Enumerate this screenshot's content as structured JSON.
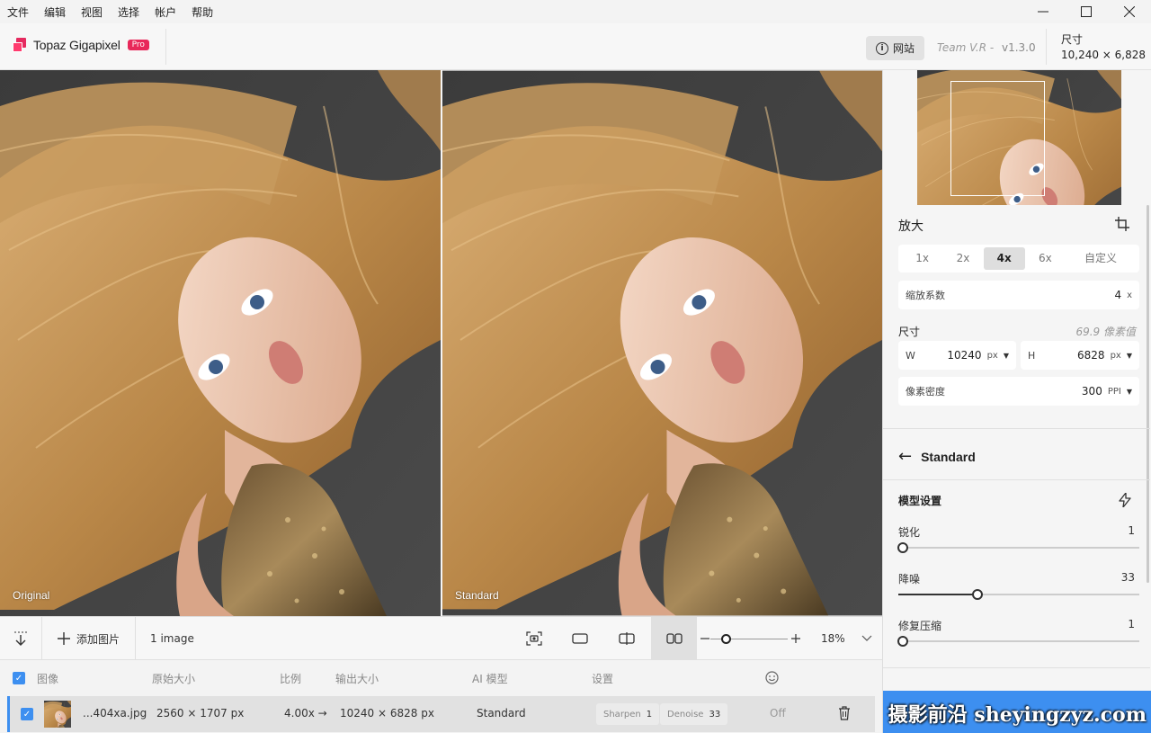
{
  "menu": [
    "文件",
    "编辑",
    "视图",
    "选择",
    "帐户",
    "帮助"
  ],
  "window_controls": {
    "minimize": "—",
    "maximize": "☐",
    "close": "✕"
  },
  "header": {
    "app_name": "Topaz Gigapixel",
    "badge": "Pro",
    "web_button": "网站",
    "team": "Team V.R -",
    "version": "v1.3.0",
    "size_label": "尺寸",
    "size_value": "10,240 × 6,828"
  },
  "panes": {
    "left_label": "Original",
    "right_label": "Standard"
  },
  "panel": {
    "upscale_title": "放大",
    "scale_options": [
      "1x",
      "2x",
      "4x",
      "6x",
      "自定义"
    ],
    "active_scale": "4x",
    "factor_label": "缩放系数",
    "factor_value": "4",
    "factor_unit": "x",
    "dimension_label": "尺寸",
    "dimension_note": "69.9 像素值",
    "width_label": "W",
    "width_value": "10240",
    "width_unit": "px",
    "height_label": "H",
    "height_value": "6828",
    "height_unit": "px",
    "density_label": "像素密度",
    "density_value": "300",
    "density_unit": "PPI",
    "model_name": "Standard",
    "model_settings_title": "模型设置",
    "sliders": [
      {
        "label": "锐化",
        "value": "1",
        "fraction": 0.02
      },
      {
        "label": "降噪",
        "value": "33",
        "fraction": 0.33
      },
      {
        "label": "修复压缩",
        "value": "1",
        "fraction": 0.02
      }
    ],
    "watermark": "摄影前沿 sheyingzyz.com"
  },
  "toolbar": {
    "add_image": "添加图片",
    "image_count": "1 image",
    "zoom_percent": "18%",
    "zoom_fraction": 0.2
  },
  "table": {
    "headers": {
      "image": "图像",
      "orig_size": "原始大小",
      "ratio": "比例",
      "out_size": "输出大小",
      "ai_model": "AI 模型",
      "settings": "设置"
    },
    "row": {
      "filename": "...404xa.jpg",
      "orig_size": "2560 × 1707 px",
      "ratio": "4.00x →",
      "out_size": "10240 × 6828 px",
      "model": "Standard",
      "sharpen_label": "Sharpen",
      "sharpen_value": "1",
      "denoise_label": "Denoise",
      "denoise_value": "33",
      "face": "Off"
    }
  },
  "colors": {
    "accent": "#3d8ff0",
    "brand": "#e8285a"
  }
}
